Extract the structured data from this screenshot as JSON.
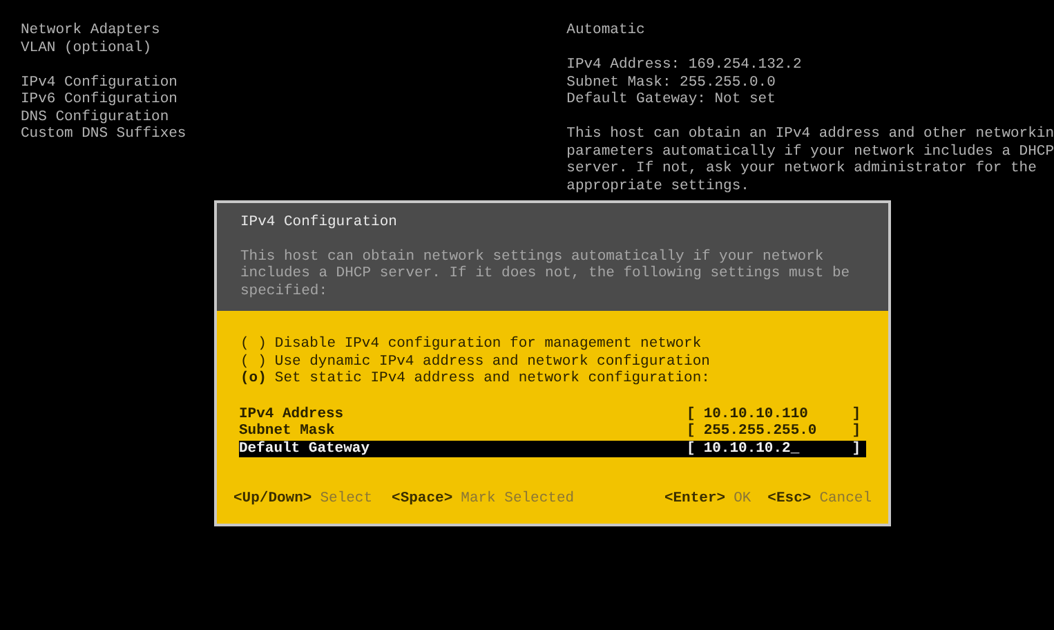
{
  "menu": {
    "groups": [
      {
        "items": [
          "Network Adapters",
          "VLAN (optional)"
        ]
      },
      {
        "items": [
          "IPv4 Configuration",
          "IPv6 Configuration",
          "DNS Configuration",
          "Custom DNS Suffixes"
        ]
      }
    ]
  },
  "details": {
    "mode": "Automatic",
    "lines": [
      "IPv4 Address: 169.254.132.2",
      "Subnet Mask: 255.255.0.0",
      "Default Gateway: Not set"
    ],
    "help": [
      "This host can obtain an IPv4 address and other networkin",
      "parameters automatically if your network includes a DHCP",
      "server. If not, ask your network administrator for the",
      "appropriate settings."
    ]
  },
  "dialog": {
    "title": "IPv4 Configuration",
    "description": [
      "This host can obtain network settings automatically if your network",
      "includes a DHCP server. If it does not, the following settings must be",
      "specified:"
    ],
    "mark_empty": "( )",
    "mark_set": "(o)",
    "options": [
      {
        "label": "Disable IPv4 configuration for management network",
        "selected": false
      },
      {
        "label": "Use dynamic IPv4 address and network configuration",
        "selected": false
      },
      {
        "label": "Set static IPv4 address and network configuration:",
        "selected": true
      }
    ],
    "fields": [
      {
        "label": "IPv4 Address",
        "open": "[",
        "value": "10.10.10.110",
        "close": "]",
        "selected": false
      },
      {
        "label": "Subnet Mask",
        "open": "[",
        "value": "255.255.255.0",
        "close": "]",
        "selected": false
      },
      {
        "label": "Default Gateway",
        "open": "[",
        "value": "10.10.10.2_",
        "close": "]",
        "selected": true
      }
    ],
    "hints_left": [
      {
        "key": "<Up/Down>",
        "action": "Select"
      },
      {
        "key": "<Space>",
        "action": "Mark Selected"
      }
    ],
    "hints_right": [
      {
        "key": "<Enter>",
        "action": "OK"
      },
      {
        "key": "<Esc>",
        "action": "Cancel"
      }
    ]
  }
}
